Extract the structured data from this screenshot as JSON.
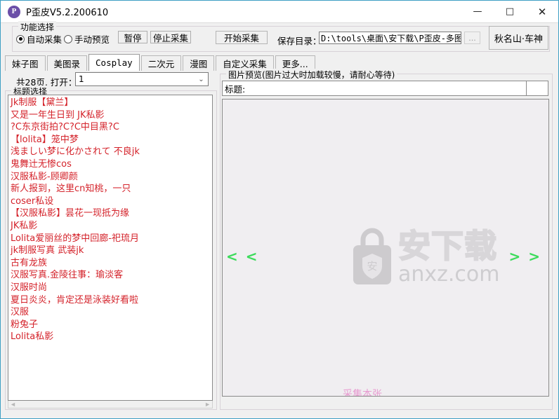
{
  "window": {
    "title": "P歪皮V5.2.200610",
    "icon": "app-logo-p",
    "minimize": "—",
    "maximize": "□",
    "close": "✕"
  },
  "function_group": {
    "legend": "功能选择",
    "radios": [
      {
        "label": "自动采集",
        "selected": true
      },
      {
        "label": "手动预览",
        "selected": false
      }
    ],
    "pause_button": "暂停",
    "stop_button": "停止采集",
    "start_button": "开始采集",
    "save_dir_label": "保存目录：",
    "save_dir_value": "D:\\tools\\桌面\\安下载\\P歪皮-多图采",
    "browse_button": "...",
    "brand_button": "秋名山·车神"
  },
  "tabs": [
    {
      "label": "妹子图",
      "active": false
    },
    {
      "label": "美图录",
      "active": false
    },
    {
      "label": "Cosplay",
      "active": true
    },
    {
      "label": "二次元",
      "active": false
    },
    {
      "label": "漫图",
      "active": false
    },
    {
      "label": "自定义采集",
      "active": false
    },
    {
      "label": "更多...",
      "active": false
    }
  ],
  "paging": {
    "label": "共28页, 打开：",
    "value": "1",
    "arrow": "⌄"
  },
  "title_select": {
    "legend": "标题选择",
    "items": [
      "Jk制服【黛兰】",
      "又是一年生日到 JK私影",
      "?C东京街拍?C?C中目黑?C",
      "【lolita】笼中梦",
      "浅ましい梦に化かされて 不良jk",
      "鬼舞辻无惨cos",
      "汉服私影-顾卿颜",
      "新人报到，这里cn知桃，一只coser私设",
      "【汉服私影】昙花一现抵为缘",
      "JK私影",
      "Lolita爱丽丝的梦中回廊-祀琉月",
      "jk制服写真 武装jk",
      "古有龙族",
      "汉服写真.金陵往事：瑜淡客",
      "汉服时尚",
      "夏日炎炎，肯定还是泳装好看啦",
      "汉服",
      "粉兔子",
      "Lolita私影"
    ]
  },
  "preview": {
    "legend": "图片预览(图片过大时加载较慢，请耐心等待)",
    "title_label": "标题:",
    "title_value": "",
    "extra_value": "",
    "prev_arrow": "< <",
    "next_arrow": "> >",
    "collect_one": "采集本张"
  },
  "watermark": {
    "cn": "安下载",
    "en": "anxz.com",
    "icon": "lock-shield-icon"
  },
  "colors": {
    "list_text": "#d4222a",
    "nav_arrow": "#3ddb5c",
    "collect_text": "#e79ad0",
    "window_border": "#3d9fc4"
  }
}
